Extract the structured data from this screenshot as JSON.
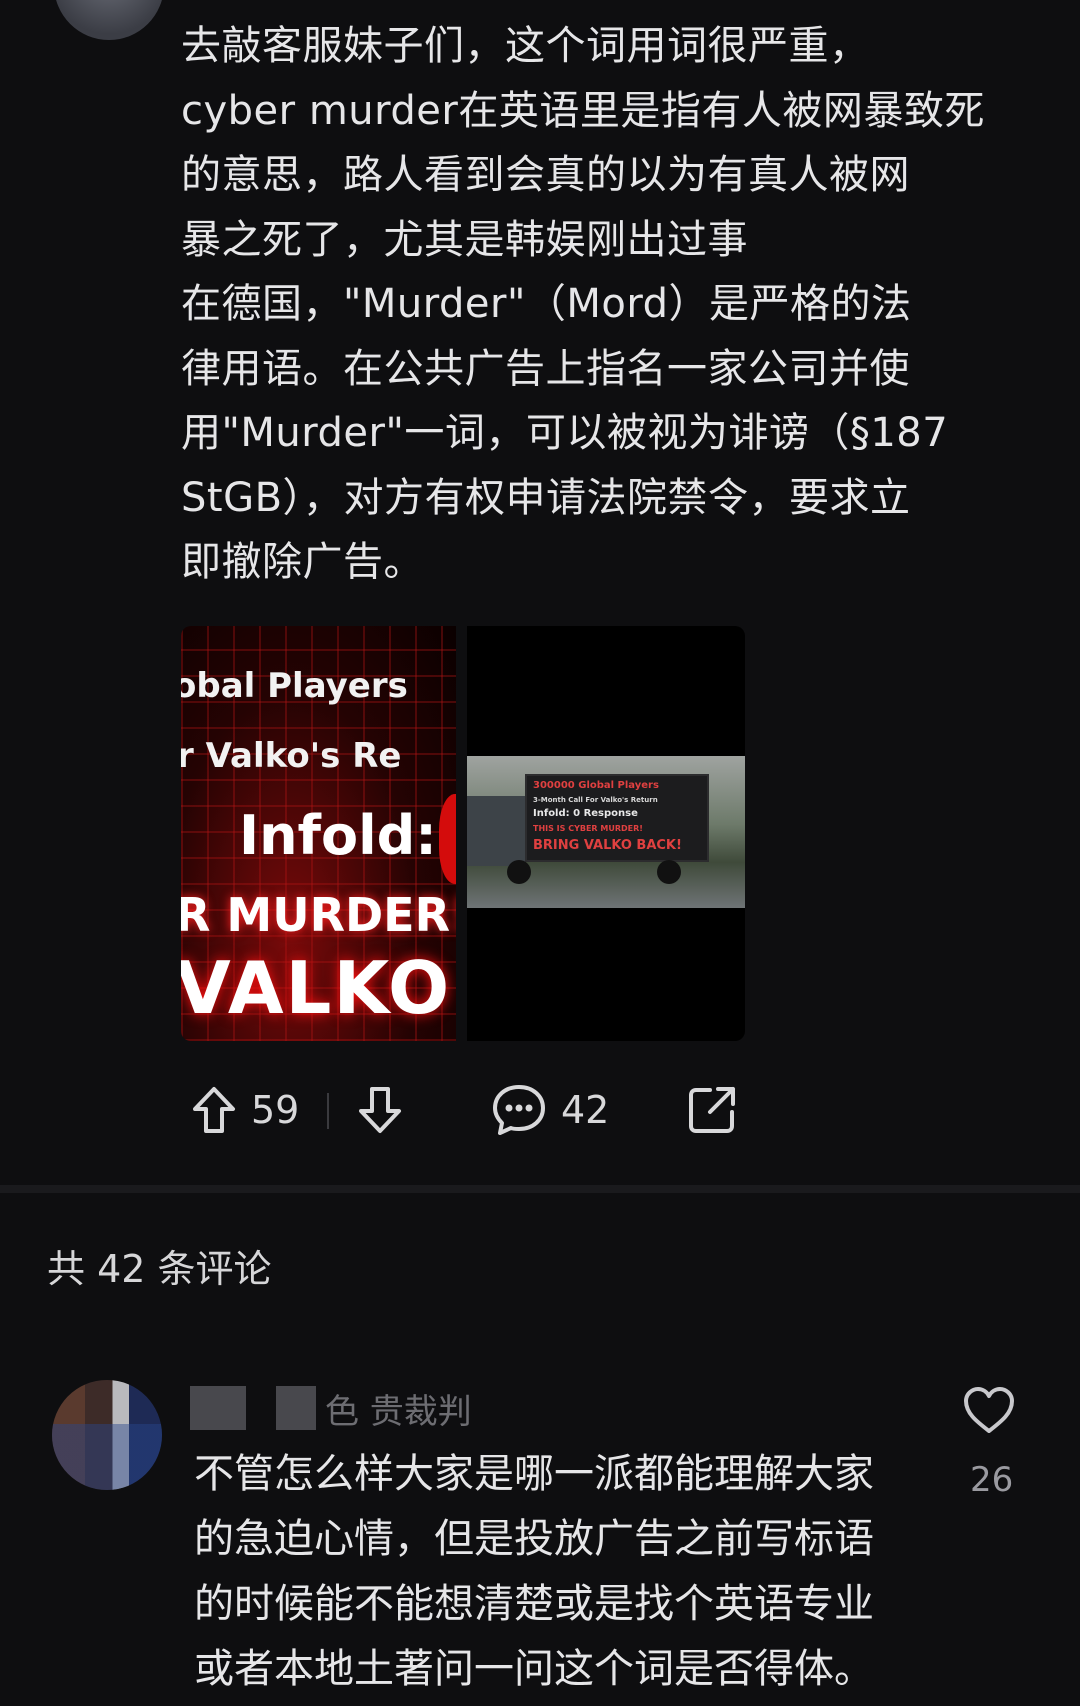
{
  "post": {
    "body_lines": [
      "去敲客服妹子们，这个词用词很严重，",
      "cyber murder在英语里是指有人被网暴致死",
      "的意思，路人看到会真的以为有真人被网",
      "暴之死了，尤其是韩娱刚出过事",
      "在德国，\"Murder\"（Mord）是严格的法",
      "律用语。在公共广告上指名一家公司并使",
      "用\"Murder\"一词，可以被视为诽谤（§187",
      "StGB），对方有权申请法院禁令，要求立",
      "即撤除广告。"
    ],
    "images": {
      "left_lines": [
        "obal Players",
        "r Valko's Re",
        "Infold:",
        "R MURDER!",
        "VALKO"
      ],
      "right_board_lines": [
        "300000 Global Players",
        "3-Month Call For Valko's Return",
        "Infold: 0 Response",
        "THIS IS CYBER MURDER!",
        "BRING VALKO BACK!"
      ]
    },
    "actions": {
      "upvotes": "59",
      "comments": "42"
    }
  },
  "comments_header": "共 42 条评论",
  "comment": {
    "author_suffix": "色 贵裁判",
    "text_lines": [
      "不管怎么样大家是哪一派都能理解大家",
      "的急迫心情，但是投放广告之前写标语",
      "的时候能不能想清楚或是找个英语专业",
      "或者本地土著问一问这个词是否得体。"
    ],
    "likes": "26"
  },
  "icons": [
    "upvote-icon",
    "downvote-icon",
    "comment-icon",
    "share-icon",
    "heart-icon"
  ],
  "colors": {
    "background": "#0e0e10",
    "text": "#e6e6e8",
    "muted": "#9a9aa0"
  }
}
